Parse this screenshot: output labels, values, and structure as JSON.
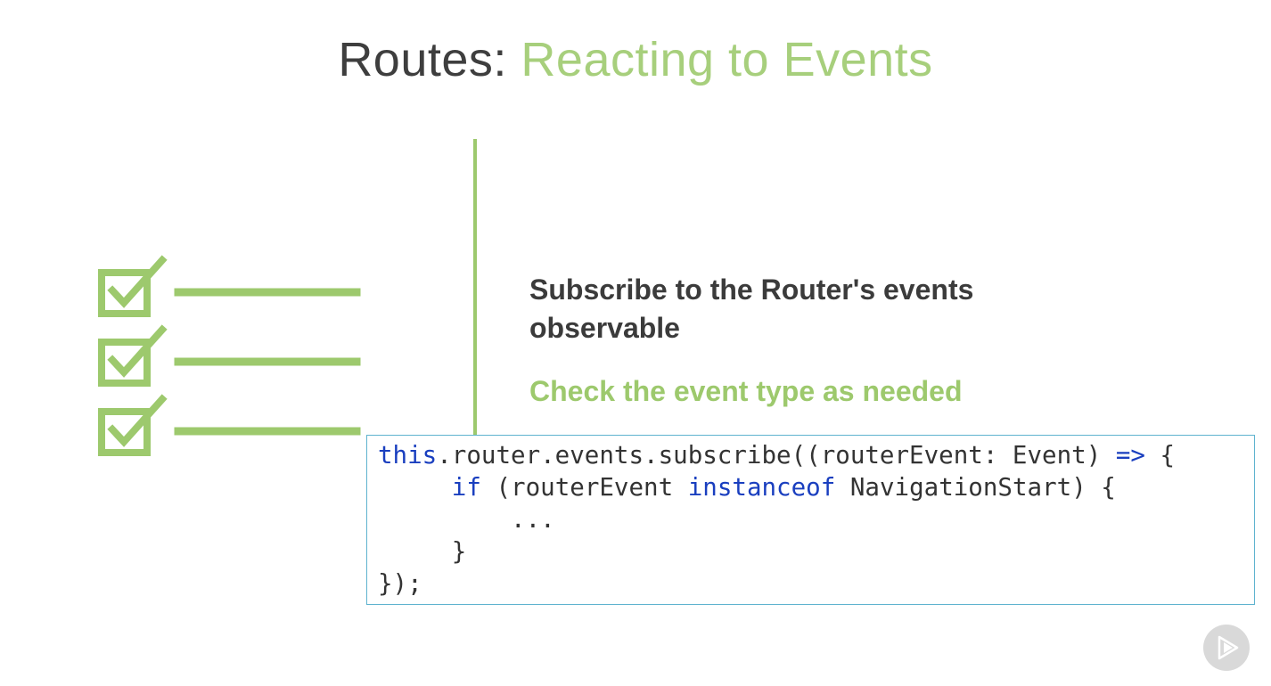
{
  "slide": {
    "title_prefix": "Routes: ",
    "title_accent": "Reacting to Events",
    "points": [
      {
        "line1": "Subscribe to the Router's events",
        "line2": "observable"
      },
      {
        "line1": "Check the event type as needed"
      }
    ]
  },
  "code": {
    "line1": {
      "kw": "this",
      "rest": ".router.events.subscribe((routerEvent: Event) ",
      "arrow": "=>",
      "tail": " {"
    },
    "line2": {
      "indent": "     ",
      "kw": "if",
      "mid": " (routerEvent ",
      "kw2": "instanceof",
      "rest": " NavigationStart) {"
    },
    "line3": "         ...",
    "line4": "     }",
    "line5": "});"
  },
  "icons": {
    "checklist": "checklist-icon",
    "play": "play-icon"
  },
  "colors": {
    "accent_green": "#9dc96d",
    "title_green": "#a7cf7c",
    "text_dark": "#3b3b3b",
    "keyword_blue": "#1a3fbf",
    "code_border": "#5fb3cf"
  }
}
